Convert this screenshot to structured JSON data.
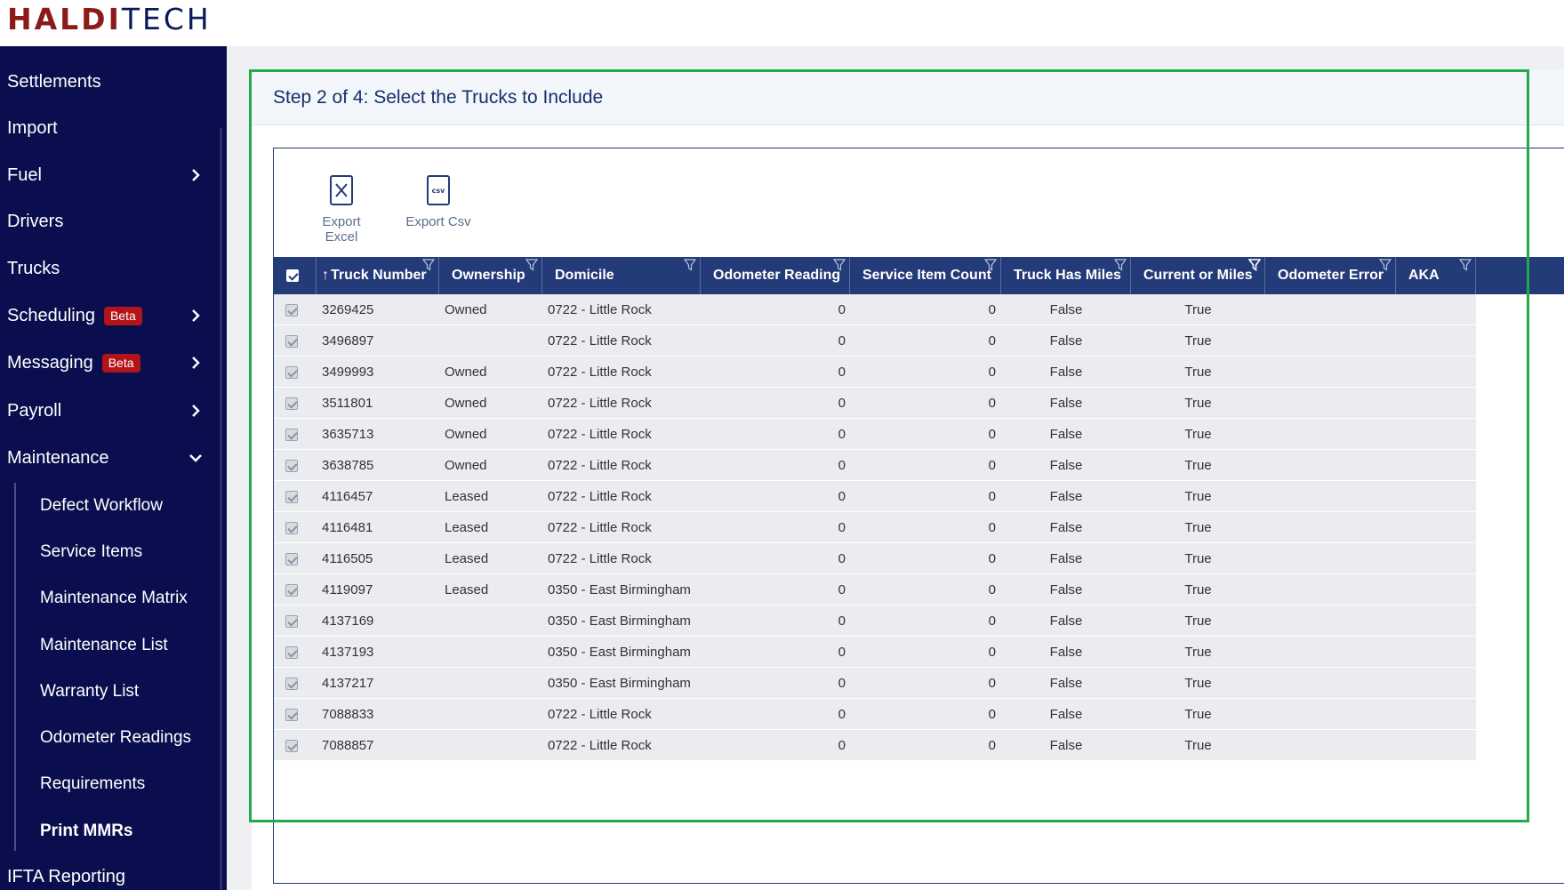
{
  "brand": {
    "part1": "HALDI",
    "part2": "TECH"
  },
  "sidebar": {
    "items": [
      {
        "label": "Settlements"
      },
      {
        "label": "Import"
      },
      {
        "label": "Fuel"
      },
      {
        "label": "Drivers"
      },
      {
        "label": "Trucks"
      },
      {
        "label": "Scheduling",
        "badge": "Beta"
      },
      {
        "label": "Messaging",
        "badge": "Beta"
      },
      {
        "label": "Payroll"
      },
      {
        "label": "Maintenance"
      },
      {
        "label": "IFTA Reporting"
      }
    ],
    "maintenance_sub": [
      {
        "label": "Defect Workflow"
      },
      {
        "label": "Service Items"
      },
      {
        "label": "Maintenance Matrix"
      },
      {
        "label": "Maintenance List"
      },
      {
        "label": "Warranty List"
      },
      {
        "label": "Odometer Readings"
      },
      {
        "label": "Requirements"
      },
      {
        "label": "Print MMRs"
      }
    ]
  },
  "step": {
    "title": "Step 2 of 4: Select the Trucks to Include"
  },
  "toolbar": {
    "export_excel": "Export Excel",
    "export_csv": "Export Csv"
  },
  "table": {
    "columns": [
      "Truck Number",
      "Ownership",
      "Domicile",
      "Odometer Reading",
      "Service Item Count",
      "Truck Has Miles",
      "Current or Miles",
      "Odometer Error",
      "AKA"
    ],
    "sort_indicator": "↑",
    "rows": [
      [
        "3269425",
        "Owned",
        "0722 - Little Rock",
        "0",
        "0",
        "False",
        "True",
        "",
        ""
      ],
      [
        "3496897",
        "",
        "0722 - Little Rock",
        "0",
        "0",
        "False",
        "True",
        "",
        ""
      ],
      [
        "3499993",
        "Owned",
        "0722 - Little Rock",
        "0",
        "0",
        "False",
        "True",
        "",
        ""
      ],
      [
        "3511801",
        "Owned",
        "0722 - Little Rock",
        "0",
        "0",
        "False",
        "True",
        "",
        ""
      ],
      [
        "3635713",
        "Owned",
        "0722 - Little Rock",
        "0",
        "0",
        "False",
        "True",
        "",
        ""
      ],
      [
        "3638785",
        "Owned",
        "0722 - Little Rock",
        "0",
        "0",
        "False",
        "True",
        "",
        ""
      ],
      [
        "4116457",
        "Leased",
        "0722 - Little Rock",
        "0",
        "0",
        "False",
        "True",
        "",
        ""
      ],
      [
        "4116481",
        "Leased",
        "0722 - Little Rock",
        "0",
        "0",
        "False",
        "True",
        "",
        ""
      ],
      [
        "4116505",
        "Leased",
        "0722 - Little Rock",
        "0",
        "0",
        "False",
        "True",
        "",
        ""
      ],
      [
        "4119097",
        "Leased",
        "0350 - East Birmingham",
        "0",
        "0",
        "False",
        "True",
        "",
        ""
      ],
      [
        "4137169",
        "",
        "0350 - East Birmingham",
        "0",
        "0",
        "False",
        "True",
        "",
        ""
      ],
      [
        "4137193",
        "",
        "0350 - East Birmingham",
        "0",
        "0",
        "False",
        "True",
        "",
        ""
      ],
      [
        "4137217",
        "",
        "0350 - East Birmingham",
        "0",
        "0",
        "False",
        "True",
        "",
        ""
      ],
      [
        "7088833",
        "",
        "0722 - Little Rock",
        "0",
        "0",
        "False",
        "True",
        "",
        ""
      ],
      [
        "7088857",
        "",
        "0722 - Little Rock",
        "0",
        "0",
        "False",
        "True",
        "",
        ""
      ]
    ]
  }
}
